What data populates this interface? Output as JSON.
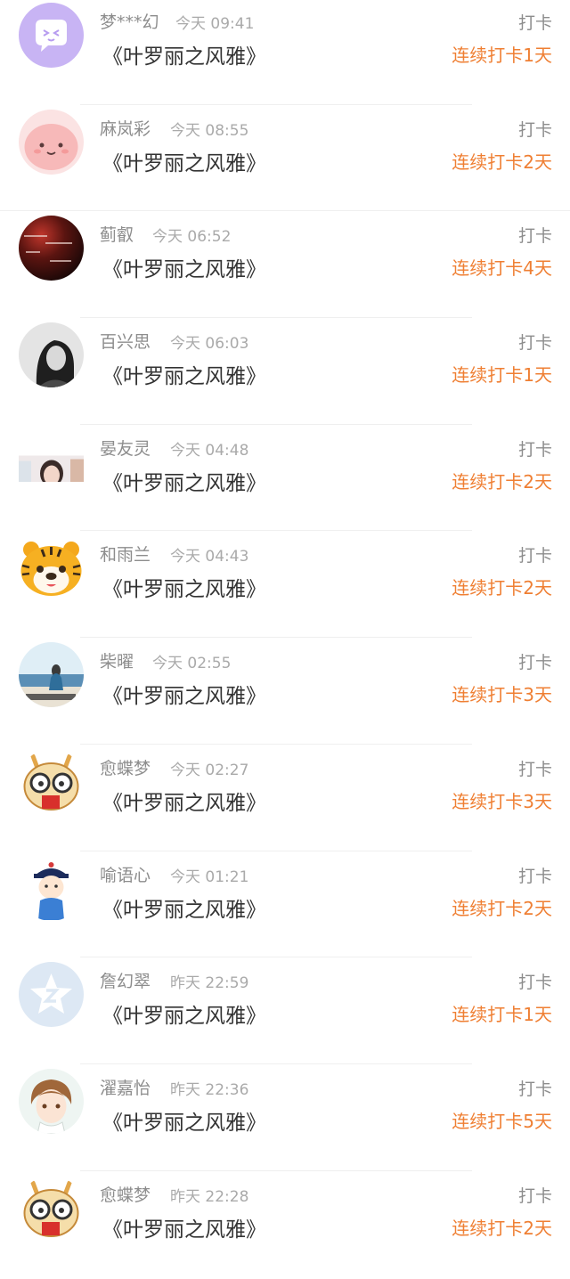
{
  "records": [
    {
      "name": "梦***幻",
      "time": "今天 09:41",
      "book": "《叶罗丽之风雅》",
      "action": "打卡",
      "streak": "连续打卡1天",
      "avatar_icon": "purple-chat-bubble-avatar-icon"
    },
    {
      "name": "麻岚彩",
      "time": "今天 08:55",
      "book": "《叶罗丽之风雅》",
      "action": "打卡",
      "streak": "连续打卡2天",
      "avatar_icon": "pink-blob-face-avatar-icon"
    },
    {
      "name": "蓟叡",
      "time": "今天 06:52",
      "book": "《叶罗丽之风雅》",
      "action": "打卡",
      "streak": "连续打卡4天",
      "avatar_icon": "dark-sunset-text-avatar-icon"
    },
    {
      "name": "百兴思",
      "time": "今天 06:03",
      "book": "《叶罗丽之风雅》",
      "action": "打卡",
      "streak": "连续打卡1天",
      "avatar_icon": "grayscale-portrait-avatar-icon"
    },
    {
      "name": "晏友灵",
      "time": "今天 04:48",
      "book": "《叶罗丽之风雅》",
      "action": "打卡",
      "streak": "连续打卡2天",
      "avatar_icon": "girl-photo-avatar-icon"
    },
    {
      "name": "和雨兰",
      "time": "今天 04:43",
      "book": "《叶罗丽之风雅》",
      "action": "打卡",
      "streak": "连续打卡2天",
      "avatar_icon": "cartoon-tiger-avatar-icon"
    },
    {
      "name": "柴曜",
      "time": "今天 02:55",
      "book": "《叶罗丽之风雅》",
      "action": "打卡",
      "streak": "连续打卡3天",
      "avatar_icon": "seaside-photo-avatar-icon"
    },
    {
      "name": "愈蝶梦",
      "time": "今天 02:27",
      "book": "《叶罗丽之风雅》",
      "action": "打卡",
      "streak": "连续打卡3天",
      "avatar_icon": "cartoon-rabbit-glasses-avatar-icon"
    },
    {
      "name": "喻语心",
      "time": "今天 01:21",
      "book": "《叶罗丽之风雅》",
      "action": "打卡",
      "streak": "连续打卡2天",
      "avatar_icon": "cartoon-qing-official-avatar-icon"
    },
    {
      "name": "詹幻翠",
      "time": "昨天 22:59",
      "book": "《叶罗丽之风雅》",
      "action": "打卡",
      "streak": "连续打卡1天",
      "avatar_icon": "default-blue-star-avatar-icon"
    },
    {
      "name": "濯嘉怡",
      "time": "昨天 22:36",
      "book": "《叶罗丽之风雅》",
      "action": "打卡",
      "streak": "连续打卡5天",
      "avatar_icon": "anime-boy-avatar-icon"
    },
    {
      "name": "愈蝶梦",
      "time": "昨天 22:28",
      "book": "《叶罗丽之风雅》",
      "action": "打卡",
      "streak": "连续打卡2天",
      "avatar_icon": "cartoon-rabbit-glasses-avatar-icon"
    }
  ]
}
